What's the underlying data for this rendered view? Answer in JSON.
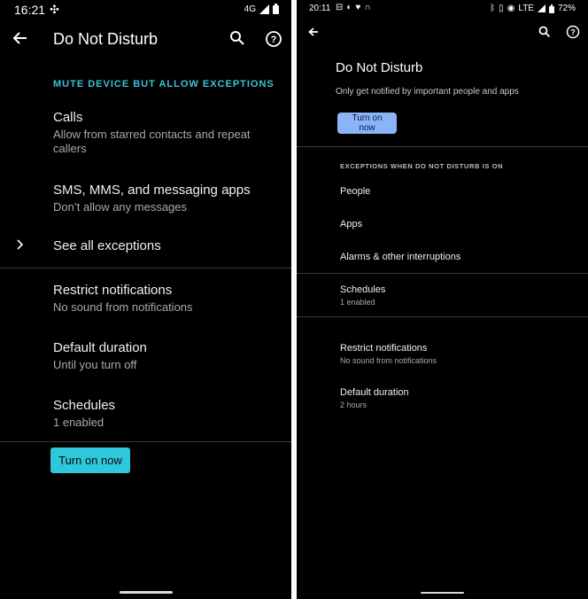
{
  "left": {
    "status": {
      "time": "16:21",
      "network": "4G",
      "battery_icon": "battery-icon"
    },
    "header": {
      "back_icon": "arrow-left-icon",
      "title": "Do Not Disturb",
      "search_icon": "search-icon",
      "help_icon": "help-circle-icon"
    },
    "section_label": "MUTE DEVICE BUT ALLOW EXCEPTIONS",
    "items": [
      {
        "title": "Calls",
        "subtitle": "Allow from starred contacts and repeat callers"
      },
      {
        "title": "SMS, MMS, and messaging apps",
        "subtitle": "Don’t allow any messages"
      },
      {
        "title": "See all exceptions",
        "icon": "chevron-right-icon"
      },
      {
        "title": "Restrict notifications",
        "subtitle": "No sound from notifications"
      },
      {
        "title": "Default duration",
        "subtitle": "Until you turn off"
      },
      {
        "title": "Schedules",
        "subtitle": "1 enabled"
      }
    ],
    "turn_on_label": "Turn on now",
    "accent": "#2fc7da"
  },
  "right": {
    "status": {
      "time": "20:11",
      "network": "LTE",
      "battery": "72%"
    },
    "header": {
      "back_icon": "arrow-left-icon",
      "search_icon": "search-icon",
      "help_icon": "help-circle-icon"
    },
    "title": "Do Not Disturb",
    "subtitle": "Only get notified by important people and apps",
    "turn_on_label": "Turn on now",
    "section_label": "EXCEPTIONS WHEN DO NOT DISTURB IS ON",
    "items": [
      {
        "title": "People"
      },
      {
        "title": "Apps"
      },
      {
        "title": "Alarms & other interruptions"
      },
      {
        "title": "Schedules",
        "subtitle": "1 enabled"
      },
      {
        "title": "Restrict notifications",
        "subtitle": "No sound from notifications"
      },
      {
        "title": "Default duration",
        "subtitle": "2 hours"
      }
    ],
    "accent": "#8ab4f8"
  }
}
